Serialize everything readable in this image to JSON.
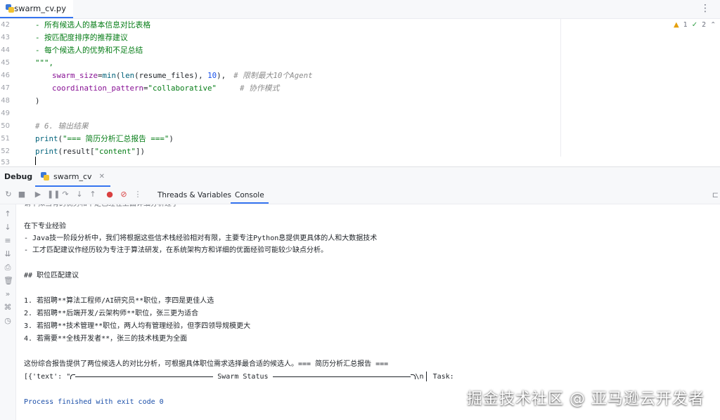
{
  "editor": {
    "tab_label": "swarm_cv.py",
    "menu_icon": "more-vertical-icon",
    "inspections": {
      "warnings": "1",
      "weak_warnings": "2"
    },
    "line_numbers": [
      "42",
      "43",
      "44",
      "45",
      "46",
      "47",
      "48",
      "49",
      "50",
      "51",
      "52",
      "53"
    ],
    "lines": {
      "l42": "- 所有候选人的基本信息对比表格",
      "l43": "- 按匹配度排序的推荐建议",
      "l44": "- 每个候选人的优势和不足总结",
      "l45": "\"\"\",",
      "l46_param": "swarm_size",
      "l46_eq": "=",
      "l46_min": "min",
      "l46_open": "(",
      "l46_len": "len",
      "l46_arg": "(resume_files), ",
      "l46_num": "10",
      "l46_close": "),",
      "l46_comment": "# 限制最大10个Agent",
      "l47_param": "coordination_pattern",
      "l47_eq": "=",
      "l47_str": "\"collaborative\"",
      "l47_comment": "# 协作模式",
      "l48": ")",
      "l50_comment": "# 6. 输出结果",
      "l51_print": "print",
      "l51_open": "(",
      "l51_str": "\"=== 简历分析汇总报告 ===\"",
      "l51_close": ")",
      "l52_print": "print",
      "l52_a": "(result[",
      "l52_str": "\"content\"",
      "l52_b": "])"
    }
  },
  "debug": {
    "title": "Debug",
    "session_tab": "swarm_cv",
    "tabs": {
      "threads": "Threads & Variables",
      "console": "Console"
    }
  },
  "console": {
    "cut_line": "请不拟当有的优势和不足已经在上面详细分析过了",
    "lines": [
      "在下专业经验",
      "- Java技一阶段分析中，我们将根据这些信术栈经验相对有限，主要专注Python息提供更具体的人和大数据技术",
      "- 工才匹配建议作经历较为专注于算法研发，在系统架构方和详细的优面经验可能较少缺点分析。",
      "## 职位匹配建议",
      "1. 若招聘**算法工程师/AI研究员**职位，李四是更佳人选",
      "2. 若招聘**后端开发/云架构师**职位，张三更为适合",
      "3. 若招聘**技术管理**职位，两人均有管理经验，但李四领导规模更大",
      "4. 若需要**全栈开发者**，张三的技术栈更为全面",
      "这份综合报告提供了两位候选人的对比分析，可根据具体职位需求选择最合适的候选人。=== 简历分析汇总报告 ==="
    ],
    "swarm_prefix": "[{'text': \"",
    "swarm_title": " Swarm Status ",
    "swarm_suffix": "\\n",
    "swarm_task": " Task:",
    "exit_line": "Process finished with exit code 0"
  },
  "watermark": "掘金技术社区 @ 亚马逊云开发者"
}
